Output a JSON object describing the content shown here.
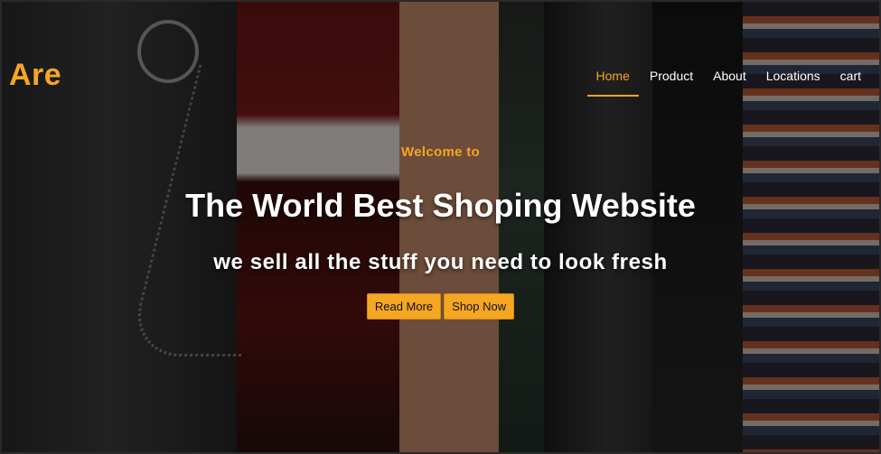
{
  "brand": {
    "logo_text": "Are",
    "accent_color": "#f5a623"
  },
  "nav": {
    "items": [
      {
        "label": "Home",
        "active": true
      },
      {
        "label": "Product",
        "active": false
      },
      {
        "label": "About",
        "active": false
      },
      {
        "label": "Locations",
        "active": false
      },
      {
        "label": "cart",
        "active": false
      }
    ]
  },
  "hero": {
    "eyebrow": "Welcome to",
    "headline": "The World Best Shoping Website",
    "subheadline": "we sell all the stuff you need to look fresh",
    "buttons": [
      {
        "label": "Read More"
      },
      {
        "label": "Shop Now"
      }
    ],
    "background": "photo of hanging clothes: denim jeans with chain, red knit sweater, striped shirts"
  }
}
